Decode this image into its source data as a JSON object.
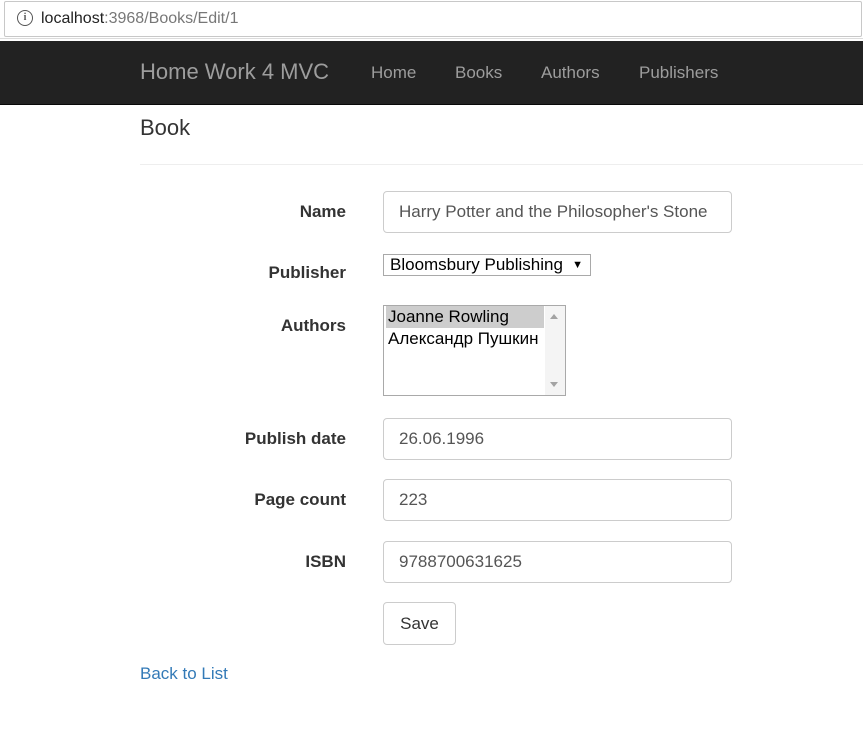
{
  "browser": {
    "url_host": "localhost",
    "url_path": ":3968/Books/Edit/1"
  },
  "navbar": {
    "brand": "Home Work 4 MVC",
    "links": [
      "Home",
      "Books",
      "Authors",
      "Publishers"
    ]
  },
  "page": {
    "title": "Book"
  },
  "form": {
    "name_label": "Name",
    "name_value": "Harry Potter and the Philosopher's Stone",
    "publisher_label": "Publisher",
    "publisher_selected": "Bloomsbury Publishing",
    "authors_label": "Authors",
    "authors_options": [
      {
        "label": "Joanne Rowling",
        "selected": true
      },
      {
        "label": "Александр Пушкин",
        "selected": false
      }
    ],
    "publish_date_label": "Publish date",
    "publish_date_value": "26.06.1996",
    "page_count_label": "Page count",
    "page_count_value": "223",
    "isbn_label": "ISBN",
    "isbn_value": "9788700631625",
    "save_label": "Save"
  },
  "footer_links": {
    "back_to_list": "Back to List"
  },
  "colors": {
    "navbar_bg": "#222222",
    "nav_text": "#9d9d9d",
    "link": "#337ab7",
    "selected_option_bg": "#cdcdcd"
  },
  "icons": {
    "site_info": "info-icon",
    "select_arrow": "dropdown-arrow-icon"
  }
}
